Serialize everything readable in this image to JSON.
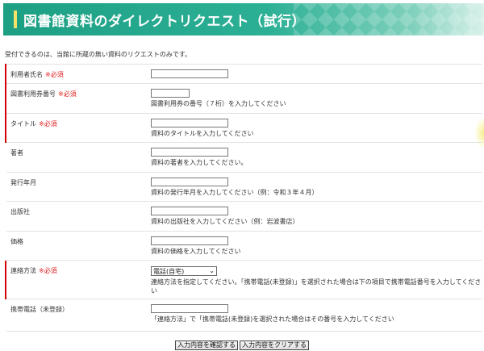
{
  "header": {
    "title": "図書館資料のダイレクトリクエスト（試行）"
  },
  "notice": "受付できるのは、当館に所蔵の無い資料のリクエストのみです。",
  "required_mark": "※必須",
  "fields": [
    {
      "label": "利用者氏名",
      "required": true,
      "value": "",
      "help": ""
    },
    {
      "label": "図書利用券番号",
      "required": true,
      "value": "",
      "help": "図書利用券の番号（７桁）を入力してください"
    },
    {
      "label": "タイトル",
      "required": true,
      "value": "",
      "help": "資料のタイトルを入力してください"
    },
    {
      "label": "著者",
      "required": false,
      "value": "",
      "help": "資料の著者を入力してください。"
    },
    {
      "label": "発行年月",
      "required": false,
      "value": "",
      "help": "資料の発行年月を入力してください（例：令和３年４月）"
    },
    {
      "label": "出版社",
      "required": false,
      "value": "",
      "help": "資料の出版社を入力してください（例：岩波書店）"
    },
    {
      "label": "価格",
      "required": false,
      "value": "",
      "help": "資料の価格を入力してください"
    },
    {
      "label": "連絡方法",
      "required": true,
      "selected": "電話(自宅)",
      "help": "連絡方法を指定してください。「携帯電話(未登録)」を選択された場合は下の項目で携帯電話番号を入力してください"
    },
    {
      "label": "携帯電話（未登録）",
      "required": false,
      "value": "",
      "help": "「連絡方法」で「携帯電話(未登録)を選択された場合はその番号を入力してください"
    }
  ],
  "buttons": {
    "confirm": "入力内容を確認する",
    "clear": "入力内容をクリアする"
  },
  "colors": {
    "banner": "#1d9f84",
    "required": "#e02020",
    "title_bar": "#f2e26a"
  }
}
